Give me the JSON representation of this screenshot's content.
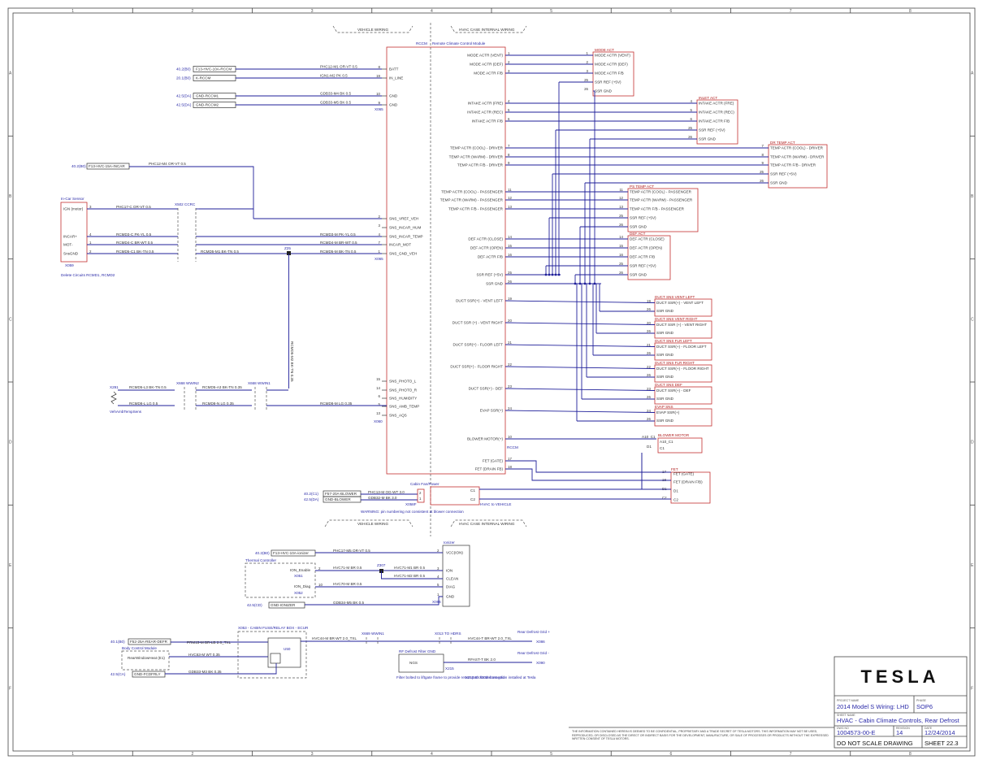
{
  "border": {
    "columns": [
      "1",
      "2",
      "3",
      "4",
      "5",
      "6",
      "7",
      "8"
    ],
    "rows": [
      "A",
      "B",
      "C",
      "D",
      "E",
      "F"
    ]
  },
  "boundary": {
    "vehicle_wiring": "VEHICLE WIRING",
    "hvac_internal": "HVAC CASE INTERNAL WIRING"
  },
  "rccm": {
    "title": "RCCM",
    "subtitle": "Remote Climate Control Module",
    "label_bottom": "RCCM",
    "left_pins": [
      {
        "pin": "8",
        "name": "BATT"
      },
      {
        "pin": "19",
        "name": "IN_LINE"
      },
      {
        "pin": "10",
        "name": "GND"
      },
      {
        "pin": "9",
        "name": "GND"
      },
      {
        "pin": "2",
        "name": "SNS_VREF_VEH"
      },
      {
        "pin": "3",
        "name": "SNS_INCAR_HUM"
      },
      {
        "pin": "4",
        "name": "SNS_INCAR_TEMP"
      },
      {
        "pin": "7",
        "name": "INCAR_MOT"
      },
      {
        "pin": "1",
        "name": "SNS_GND_VEH"
      },
      {
        "pin": "15",
        "name": "SNS_PHOTO_L"
      },
      {
        "pin": "14",
        "name": "SNS_PHOTO_R"
      },
      {
        "pin": "6",
        "name": "SNS_HUMIDITY"
      },
      {
        "pin": "5",
        "name": "SNS_AMB_TEMP"
      },
      {
        "pin": "13",
        "name": "SNS_AQS"
      }
    ],
    "right_pins": [
      {
        "pin": "1",
        "name": "MODE ACTR (VENT)"
      },
      {
        "pin": "2",
        "name": "MODE ACTR (DEF)"
      },
      {
        "pin": "3",
        "name": "MODE ACTR F/B"
      },
      {
        "pin": "4",
        "name": "INTAKE ACTR (FRE)"
      },
      {
        "pin": "5",
        "name": "INTAKE ACTR (REC)"
      },
      {
        "pin": "6",
        "name": "INTAKE ACTR F/B"
      },
      {
        "pin": "7",
        "name": "TEMP ACTR (COOL) - DRIVER"
      },
      {
        "pin": "8",
        "name": "TEMP ACTR (WARM) - DRIVER"
      },
      {
        "pin": "9",
        "name": "TEMP ACTR F/B - DRIVER"
      },
      {
        "pin": "11",
        "name": "TEMP ACTR (COOL) - PASSENGER"
      },
      {
        "pin": "12",
        "name": "TEMP ACTR (WARM) - PASSENGER"
      },
      {
        "pin": "13",
        "name": "TEMP ACTR F/B - PASSENGER"
      },
      {
        "pin": "14",
        "name": "DEF ACTR (CLOSE)"
      },
      {
        "pin": "15",
        "name": "DEF ACTR (OPEN)"
      },
      {
        "pin": "16",
        "name": "DEF ACTR F/B"
      },
      {
        "pin": "25",
        "name": "SSR REF (+5V)"
      },
      {
        "pin": "26",
        "name": "SSR GND"
      },
      {
        "pin": "19",
        "name": "DUCT SSR(+) - VENT LEFT"
      },
      {
        "pin": "20",
        "name": "DUCT SSR (+) - VENT RIGHT"
      },
      {
        "pin": "21",
        "name": "DUCT SSR(+) - FLOOR LEFT"
      },
      {
        "pin": "22",
        "name": "DUCT SSR(+) - FLOOR RIGHT"
      },
      {
        "pin": "23",
        "name": "DUCT SSR(+) - DEF"
      },
      {
        "pin": "24",
        "name": "EVAP SSR(+)"
      },
      {
        "pin": "10",
        "name": "BLOWER MOTOR(+)"
      },
      {
        "pin": "17",
        "name": "FET (GATE)"
      },
      {
        "pin": "18",
        "name": "FET (DRAIN FB)"
      }
    ]
  },
  "actuators": [
    {
      "title": "MODE ACT",
      "pins": [
        {
          "p": "1",
          "n": "MODE ACTR (VENT)"
        },
        {
          "p": "2",
          "n": "MODE ACTR (DEF)"
        },
        {
          "p": "3",
          "n": "MODE ACTR F/B"
        },
        {
          "p": "25",
          "n": "SSR REF (+5V)"
        },
        {
          "p": "26",
          "n": "SSR GND"
        }
      ]
    },
    {
      "title": "INLET ACT",
      "pins": [
        {
          "p": "4",
          "n": "INTAKE ACTR (FRE)"
        },
        {
          "p": "5",
          "n": "INTAKE ACTR (REC)"
        },
        {
          "p": "6",
          "n": "INTAKE ACTR F/B"
        },
        {
          "p": "25",
          "n": "SSR REF (+5V)"
        },
        {
          "p": "26",
          "n": "SSR GND"
        }
      ]
    },
    {
      "title": "DR TEMP ACT",
      "pins": [
        {
          "p": "7",
          "n": "TEMP ACTR (COOL) - DRIVER"
        },
        {
          "p": "8",
          "n": "TEMP ACTR (WARM) - DRIVER"
        },
        {
          "p": "9",
          "n": "TEMP ACTR F/B - DRIVER"
        },
        {
          "p": "25",
          "n": "SSR REF (+5V)"
        },
        {
          "p": "26",
          "n": "SSR GND"
        }
      ]
    },
    {
      "title": "PS TEMP ACT",
      "pins": [
        {
          "p": "11",
          "n": "TEMP ACTR (COOL) - PASSENGER"
        },
        {
          "p": "12",
          "n": "TEMP ACTR (WARM) - PASSENGER"
        },
        {
          "p": "13",
          "n": "TEMP ACTR F/B - PASSENGER"
        },
        {
          "p": "25",
          "n": "SSR REF (+5V)"
        },
        {
          "p": "26",
          "n": "SSR GND"
        }
      ]
    },
    {
      "title": "DEF ACT",
      "pins": [
        {
          "p": "14",
          "n": "DEF ACTR (CLOSE)"
        },
        {
          "p": "15",
          "n": "DEF ACTR (OPEN)"
        },
        {
          "p": "16",
          "n": "DEF ACTR F/B"
        },
        {
          "p": "25",
          "n": "SSR REF (+5V)"
        },
        {
          "p": "26",
          "n": "SSR GND"
        }
      ]
    }
  ],
  "duct_sensors": [
    {
      "title": "DUCT SNS VENT LEFT",
      "a": "19",
      "an": "DUCT SSR(+) - VENT LEFT"
    },
    {
      "title": "DUCT SNS VENT RIGHT",
      "a": "20",
      "an": "DUCT SSR (+) - VENT RIGHT"
    },
    {
      "title": "DUCT SNS FLR LEFT",
      "a": "21",
      "an": "DUCT SSR(+) - FLOOR LEFT"
    },
    {
      "title": "DUCT SNS FLR RIGHT",
      "a": "22",
      "an": "DUCT SSR(+) - FLOOR RIGHT"
    },
    {
      "title": "DUCT SNS DEF",
      "a": "23",
      "an": "DUCT SSR(+) - DEF"
    },
    {
      "title": "EVAP SNS",
      "a": "24",
      "an": "EVAP SSR(+)"
    }
  ],
  "ssr_gnd": "SSR GND",
  "ssr_gnd_pin": "26",
  "blower": {
    "title": "BLOWER MOTOR",
    "conn": "A10_C1",
    "p1": "C1",
    "p2": "D1",
    "pin": "A10_C1"
  },
  "fet": {
    "title": "FET",
    "pins": [
      {
        "p": "17",
        "n": "FET (GATE)"
      },
      {
        "p": "18",
        "n": "FET (DRAIN F/B)"
      },
      {
        "p": "D1",
        "n": "D1"
      },
      {
        "p": "C2",
        "n": "C2"
      }
    ]
  },
  "left_inputs": [
    {
      "ref": "40.2(B0)",
      "conn": "F13-HVC-10A-RCCM",
      "wire": "PHC12-M1 OR-VT 0.5"
    },
    {
      "ref": "20.1(B0)",
      "conn": "K-RCCM",
      "wire": "IGN1-M2 PK 0.5"
    },
    {
      "ref": "42.5(DA)",
      "conn": "GND-RCCM1",
      "wire": "GDB33-M4 BK 0.5"
    },
    {
      "ref": "42.5(DA)",
      "conn": "GND-RCCM2",
      "wire": "GDB33-M5 BK 0.5"
    }
  ],
  "incar": {
    "title": "In-Car Sensor",
    "feed_ref": "40.2(B0)",
    "feed_conn": "F13-HVC-15A-INCAR",
    "feed_wire": "PHC12-M4 OR-VT 0.5",
    "pins": [
      {
        "p": "3",
        "n": "IGN (motor)",
        "wire": "PHC17-C OR-VT 0.5"
      },
      {
        "p": "4",
        "n": "INCAR+",
        "wire": "RCMD3-C PK-YL 0.5"
      },
      {
        "p": "1",
        "n": "MOT-",
        "wire": "RCMD4-C BR-WT 0.5"
      },
      {
        "p": "2",
        "n": "SnsGND",
        "wire": "RCMD5-C1 BK-TN 0.5"
      }
    ],
    "conn": "X059",
    "inline": "X502 CCRC",
    "splice": "Z25",
    "note": "Delete Circuits RCMD1, RCMD2",
    "rcmd_wires": [
      "RCMD3-M PK-YL 0.5",
      "RCMD4-M BR-WT 0.5",
      "RCMD5-M1 BK-TN 0.5",
      "RCMD5-M BK-TN 0.5"
    ],
    "vertical_wire": "RCMD5-M2 BK-TN 0.35"
  },
  "amb_temp": {
    "conn": "X291",
    "title": "VehAmbTempSens",
    "wire1": "RCMD5-L3 BK-TN 0.5",
    "wire2": "RCMD8-L LG 0.5",
    "inline": "X668 WWIN2",
    "inline2": "X668 WWIN1",
    "wire3": "RCMD5-A3 BK-TN 0.35",
    "wire4": "RCMD8-N LG 0.35",
    "wire5": "RCMD8-M LG 0.35",
    "conn_end": "X060"
  },
  "cabin_fan": {
    "title": "Cabin Fan/Power",
    "ref1": "40.2(C1)",
    "conn1": "F57-20A-BLOWER",
    "wire1": "PHC13-M OG-WT 3.0",
    "ref2": "42.5(DA)",
    "conn2": "GND-BLOWER",
    "wire2": "GDB32-M BK 3.0",
    "conn": "X058F",
    "warning": "WARNING: pin numbering not consistent at blower connection",
    "hvac_label": "HVAC to VEHICLE",
    "c1": "C1",
    "c2": "C2"
  },
  "ionizer": {
    "title": "Ionizer",
    "feed_ref": "40.2(B0)",
    "feed_conn": "F13-HVC-10A-ionizer",
    "feed_wire": "PHC17-M5 OR-VT 0.5",
    "pins": [
      {
        "p": "2",
        "n": "VCC(ION)"
      },
      {
        "p": "3",
        "n": "ION"
      },
      {
        "p": "4",
        "n": "CLEAN"
      },
      {
        "p": "5",
        "n": "DIAG"
      },
      {
        "p": "1",
        "n": "GND"
      }
    ],
    "thermal": "Thermal Controller",
    "ion_enable": "ION_Enable",
    "ion_diag": "ION_Diag",
    "w_ion": "HVC71-M BR 0.5",
    "w_ion2": "HVC71-M1 BR 0.5",
    "w_clean": "HVC71-M2 BR 0.5",
    "w_diag": "HVC70-M BR 0.5",
    "splice": "Z307",
    "c1": "X051",
    "c2": "X052",
    "gnd_ref": "42.5(CD)",
    "gnd_conn": "GND-IONIZER",
    "gnd_wire": "GDB34-M5 BK 0.5",
    "pin_a": "2",
    "pin_b": "10",
    "conn_end": "X066"
  },
  "rear_defrost": {
    "ref": "40.1(B0)",
    "conn": "F52-25A-REAR-DEFR",
    "wire1": "PRM15-M BR-LB 2.0_TXL",
    "box": "X053 - CABIN FUSE/RELAY BOX - ECUR",
    "ctrl": "Body Control Module",
    "rwd": "RearWindowHeat (E1)",
    "wire2": "HVC63-M WT 0.35",
    "relay": "U50",
    "gnd_ref": "42.5(CA)",
    "gnd_conn": "GND-FCDFRLY",
    "gnd_wire": "GDB33-M3 BK 0.35",
    "wire3": "HVC44-M BR-WT 2.0_TXL",
    "inline": "X669 WWIN1",
    "inline2": "X013 TO HDRS",
    "wire4": "HVC44-T BR-WT 2.0_TXL",
    "grid_plus": "Rear Defrost Grid +",
    "grid_minus": "Rear Defrost Grid -",
    "rf_filter": "RF Defrost Filter GND",
    "ngs": "NGS",
    "rf_wire": "RFAST-T BK 2.0",
    "rf_note": "Filter bolted to liftgate frame to provide return path for defrost grid",
    "rf_note2": "X215 to X030 connection installed at Tesla",
    "x086": "X086",
    "x090": "X090",
    "x216": "X215"
  },
  "title_block": {
    "brand": "TESLA",
    "project_label": "PROJECT NAME",
    "project": "2014 Model S Wiring: LHD",
    "phase_label": "PHASE",
    "phase": "SOP6",
    "sheet_label": "SHEET NAME",
    "sheet_name": "HVAC - Cabin Climate Controls, Rear Defrost",
    "dwg_label": "DWG NO",
    "dwg": "1004573-00-E",
    "rev_label": "REVISION",
    "rev": "14",
    "date_label": "DATE",
    "date": "12/24/2014",
    "do_not_scale": "DO NOT SCALE DRAWING",
    "sheet": "SHEET 22.3",
    "confidential": "THE INFORMATION CONTAINED HEREIN IS DEEMED TO BE CONFIDENTIAL, PROPRIETARY AND A TRADE SECRET OF TESLA MOTORS. THIS INFORMATION MAY NOT BE USED, REPRODUCED, OR DISCLOSED AS THE DIRECT OR INDIRECT BASIS FOR THE DEVELOPMENT, MANUFACTURE, OR SALE OF PROCESSES OR PRODUCTS WITHOUT THE EXPRESSED WRITTEN CONSENT OF TESLA MOTORS."
  },
  "colors": {
    "wire": "#1f1f9a",
    "component": "#c43030",
    "frame": "#444444"
  }
}
